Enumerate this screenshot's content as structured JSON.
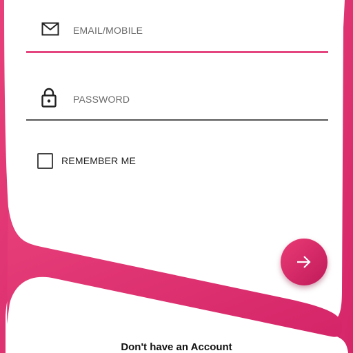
{
  "colors": {
    "accent": "#e4457f",
    "accent_dark": "#c01a5a",
    "background": "#ffffff"
  },
  "form": {
    "email": {
      "placeholder": "EMAIL/MOBILE",
      "icon": "mail-icon"
    },
    "password": {
      "placeholder": "PASSWORD",
      "icon": "lock-icon"
    },
    "remember": {
      "label": "REMEMBER ME",
      "checked": false
    },
    "submit": {
      "icon": "arrow-right-icon"
    }
  },
  "footer": {
    "signup_text": "Don't have an Account"
  }
}
